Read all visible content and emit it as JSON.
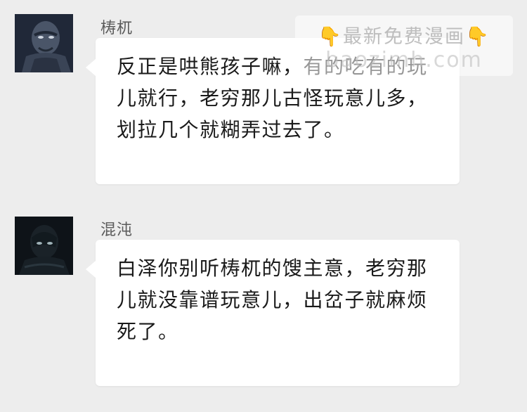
{
  "messages": [
    {
      "sender": "梼杌",
      "text": "反正是哄熊孩子嘛，有的吃有的玩\n儿就行，老穷那儿古怪玩意儿多，\n划拉几个就糊弄过去了。"
    },
    {
      "sender": "混沌",
      "text": "白泽你别听梼杌的馊主意，老穷那\n儿就没靠谱玩意儿，出岔子就麻烦\n死了。"
    }
  ],
  "watermark": {
    "hand_left": "👇",
    "title": "最新免费漫画",
    "hand_right": "👇",
    "url": "baozimh.com"
  },
  "colors": {
    "background": "#ededed",
    "bubble": "#ffffff",
    "sender": "#5a5a5a",
    "text": "#1a1a1a"
  }
}
